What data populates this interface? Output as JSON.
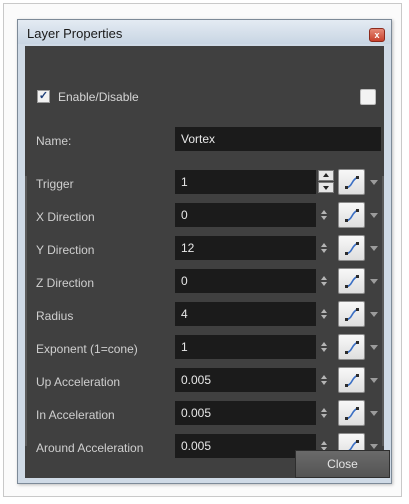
{
  "window": {
    "title": "Layer Properties",
    "close_glyph": "x"
  },
  "enable": {
    "label": "Enable/Disable",
    "checked": true,
    "check_glyph": "✓"
  },
  "name": {
    "label": "Name:",
    "value": "Vortex"
  },
  "parameters": [
    {
      "label": "Trigger",
      "value": "1"
    },
    {
      "label": "X Direction",
      "value": "0"
    },
    {
      "label": "Y Direction",
      "value": "12"
    },
    {
      "label": "Z Direction",
      "value": "0"
    },
    {
      "label": "Radius",
      "value": "4"
    },
    {
      "label": "Exponent (1=cone)",
      "value": "1"
    },
    {
      "label": "Up Acceleration",
      "value": "0.005"
    },
    {
      "label": "In Acceleration",
      "value": "0.005"
    },
    {
      "label": "Around Acceleration",
      "value": "0.005"
    }
  ],
  "footer": {
    "close_label": "Close"
  },
  "colors": {
    "panel_bg": "#404040",
    "field_bg": "#1b1b1b",
    "checkmark": "#1e3f7a",
    "function_icon_curve": "#3b6fc4"
  },
  "icons": {
    "function_button": "function-curve-icon",
    "spinner": "spinner-arrows-icon",
    "dropdown": "chevron-down-icon"
  }
}
